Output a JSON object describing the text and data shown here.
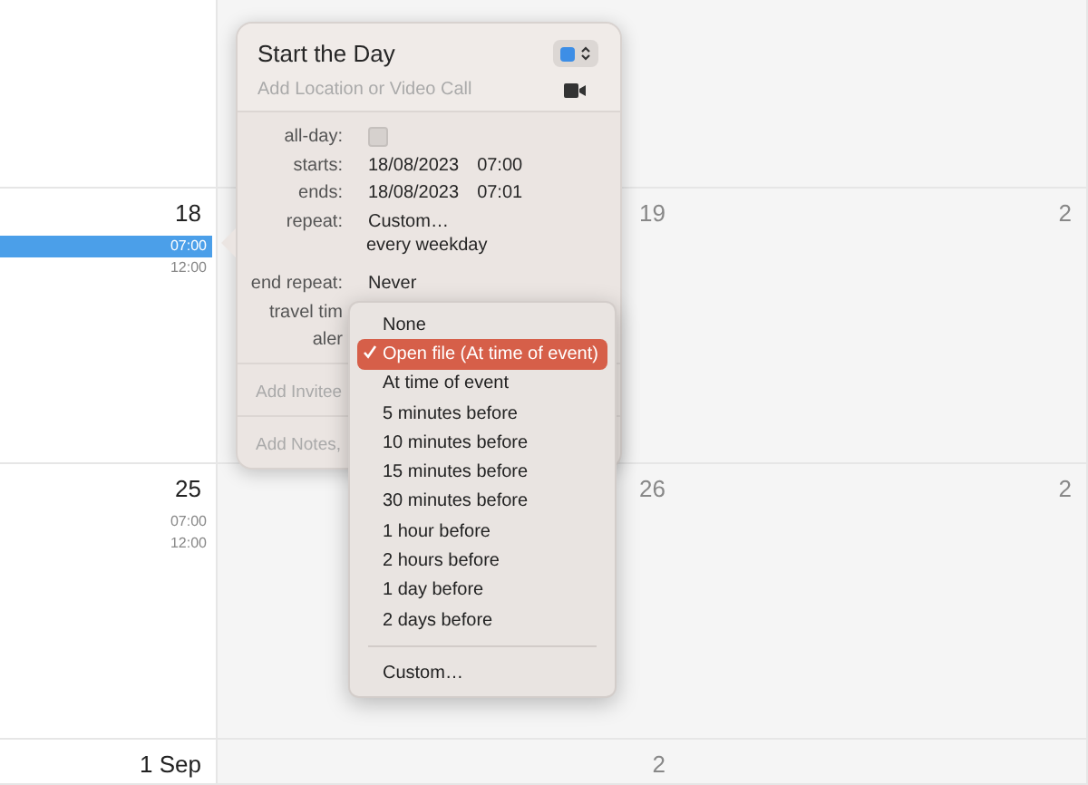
{
  "calendar": {
    "columns": [
      {
        "weekend": false
      },
      {
        "weekend": true
      },
      {
        "weekend": true
      }
    ],
    "weeks": [
      {
        "days": [
          {
            "number": "18",
            "events": [
              {
                "time": "07:00",
                "selected": true
              },
              {
                "time": "12:00",
                "selected": false
              }
            ]
          },
          {
            "number": "19"
          },
          {
            "number": "2"
          }
        ]
      },
      {
        "days": [
          {
            "number": "25",
            "events": [
              {
                "time": "07:00",
                "selected": false
              },
              {
                "time": "12:00",
                "selected": false
              }
            ]
          },
          {
            "number": "26"
          },
          {
            "number": "2"
          }
        ]
      },
      {
        "days": [
          {
            "number": "1 Sep"
          },
          {
            "number": "2"
          }
        ]
      }
    ]
  },
  "event_popover": {
    "title": "Start the Day",
    "color": "#3d8ee6",
    "location_placeholder": "Add Location or Video Call",
    "fields": [
      {
        "kind": "checkbox",
        "label": "all-day:",
        "checked": false
      },
      {
        "kind": "text",
        "label": "starts:",
        "values": [
          "18/08/2023",
          "07:00"
        ]
      },
      {
        "kind": "text",
        "label": "ends:",
        "values": [
          "18/08/2023",
          "07:01"
        ]
      },
      {
        "kind": "text",
        "label": "repeat:",
        "values": [
          "Custom…"
        ],
        "detail": "every weekday"
      },
      {
        "kind": "text",
        "label": "end repeat:",
        "values": [
          "Never"
        ]
      },
      {
        "kind": "label",
        "label": "travel tim"
      },
      {
        "kind": "label",
        "label": "aler"
      }
    ],
    "invitees_placeholder": "Add Invitee",
    "notes_placeholder": "Add Notes,"
  },
  "alert_menu": {
    "items": [
      {
        "kind": "option",
        "label": "None",
        "selected": false
      },
      {
        "kind": "option",
        "label": "Open file (At time of event)",
        "selected": true
      },
      {
        "kind": "option",
        "label": "At time of event",
        "selected": false
      },
      {
        "kind": "option",
        "label": "5 minutes before",
        "selected": false
      },
      {
        "kind": "option",
        "label": "10 minutes before",
        "selected": false
      },
      {
        "kind": "option",
        "label": "15 minutes before",
        "selected": false
      },
      {
        "kind": "option",
        "label": "30 minutes before",
        "selected": false
      },
      {
        "kind": "option",
        "label": "1 hour before",
        "selected": false
      },
      {
        "kind": "option",
        "label": "2 hours before",
        "selected": false
      },
      {
        "kind": "option",
        "label": "1 day before",
        "selected": false
      },
      {
        "kind": "option",
        "label": "2 days before",
        "selected": false
      },
      {
        "kind": "separator"
      },
      {
        "kind": "option",
        "label": "Custom…",
        "selected": false
      }
    ]
  }
}
